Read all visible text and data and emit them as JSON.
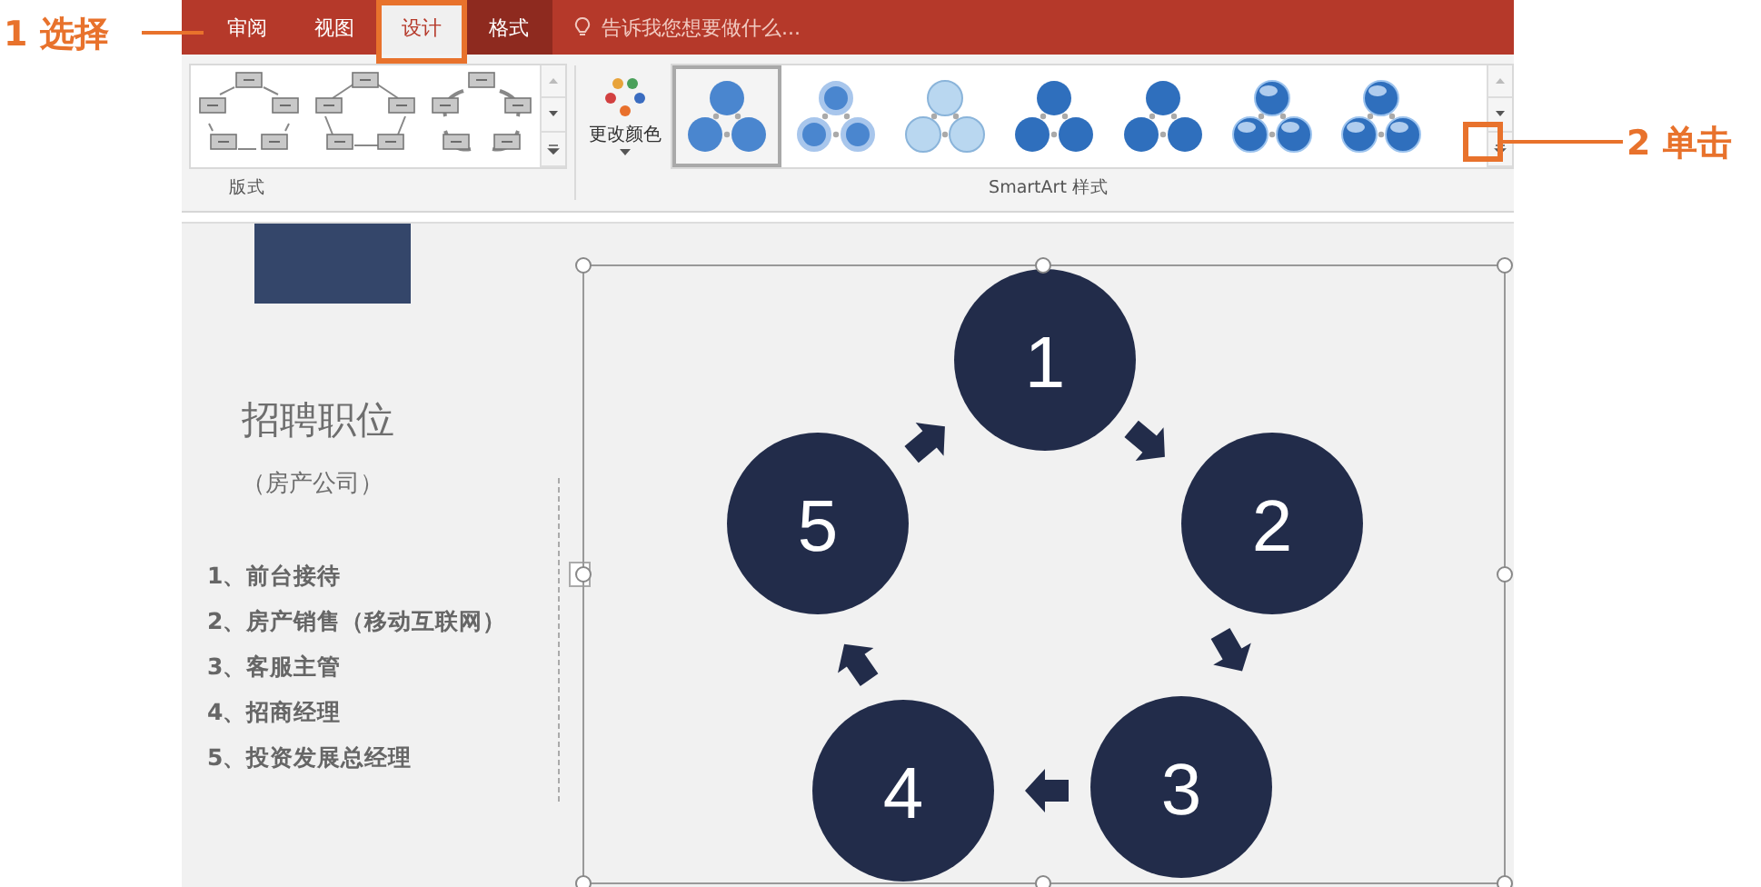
{
  "annotations": [
    {
      "number": "1",
      "label": "选择"
    },
    {
      "number": "2",
      "label": "单击"
    }
  ],
  "tabs": [
    {
      "label": "审阅",
      "selected": false,
      "kind": "normal"
    },
    {
      "label": "视图",
      "selected": false,
      "kind": "normal"
    },
    {
      "label": "设计",
      "selected": true,
      "kind": "normal"
    },
    {
      "label": "格式",
      "selected": false,
      "kind": "contextual"
    }
  ],
  "tell_me": {
    "placeholder": "告诉我您想要做什么..."
  },
  "layouts": {
    "label": "版式",
    "items": [
      {
        "kind": "arrows"
      },
      {
        "kind": "plain"
      },
      {
        "kind": "loop"
      }
    ]
  },
  "change_colors": {
    "label": "更改颜色"
  },
  "styles": {
    "label": "SmartArt 样式",
    "items": [
      {
        "selected": true,
        "kind": "flat"
      },
      {
        "selected": false,
        "kind": "ring"
      },
      {
        "selected": false,
        "kind": "pale"
      },
      {
        "selected": false,
        "kind": "solid"
      },
      {
        "selected": false,
        "kind": "solid"
      },
      {
        "selected": false,
        "kind": "shiny"
      },
      {
        "selected": false,
        "kind": "shiny"
      }
    ]
  },
  "slide": {
    "title": "招聘职位",
    "subtitle": "（房产公司）",
    "items": [
      "1、前台接待",
      "2、房产销售（移动互联网）",
      "3、客服主管",
      "4、招商经理",
      "5、投资发展总经理"
    ],
    "diagram": {
      "nodes": [
        "1",
        "2",
        "3",
        "4",
        "5"
      ]
    }
  }
}
